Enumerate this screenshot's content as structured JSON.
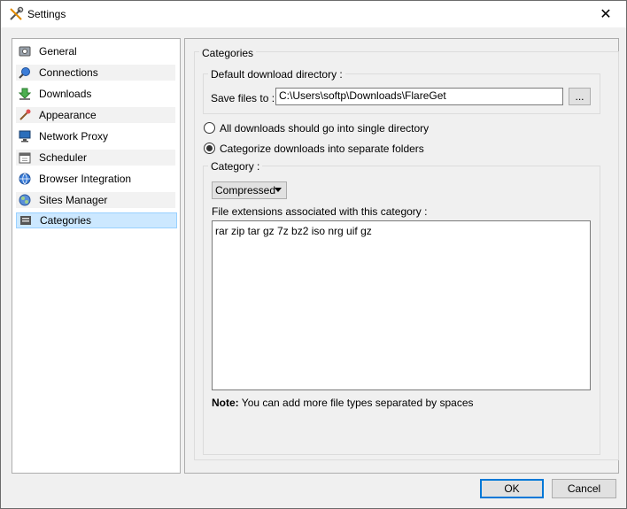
{
  "window": {
    "title": "Settings"
  },
  "sidebar": {
    "items": [
      {
        "label": "General",
        "icon": "general-icon"
      },
      {
        "label": "Connections",
        "icon": "connections-icon"
      },
      {
        "label": "Downloads",
        "icon": "downloads-icon"
      },
      {
        "label": "Appearance",
        "icon": "appearance-icon"
      },
      {
        "label": "Network Proxy",
        "icon": "network-proxy-icon"
      },
      {
        "label": "Scheduler",
        "icon": "scheduler-icon"
      },
      {
        "label": "Browser Integration",
        "icon": "browser-integration-icon"
      },
      {
        "label": "Sites Manager",
        "icon": "sites-manager-icon"
      },
      {
        "label": "Categories",
        "icon": "categories-icon"
      }
    ],
    "selected": "Categories"
  },
  "main": {
    "group_title": "Categories",
    "default_dir": {
      "title": "Default download directory :",
      "save_label": "Save files to :",
      "path": "C:\\Users\\softp\\Downloads\\FlareGet",
      "browse_label": "..."
    },
    "radio_single": {
      "label": "All downloads should go into single directory",
      "checked": false
    },
    "radio_categorize": {
      "label": "Categorize downloads into separate folders",
      "checked": true
    },
    "category": {
      "title": "Category :",
      "selected": "Compressed",
      "extensions_label": "File extensions associated with this category :",
      "extensions": "rar zip tar gz 7z bz2 iso nrg uif gz",
      "note_bold": "Note:",
      "note_text": " You can add more file types separated by spaces"
    }
  },
  "footer": {
    "ok_label": "OK",
    "cancel_label": "Cancel"
  },
  "colors": {
    "selection": "#cce8ff",
    "accent": "#0078d7"
  }
}
